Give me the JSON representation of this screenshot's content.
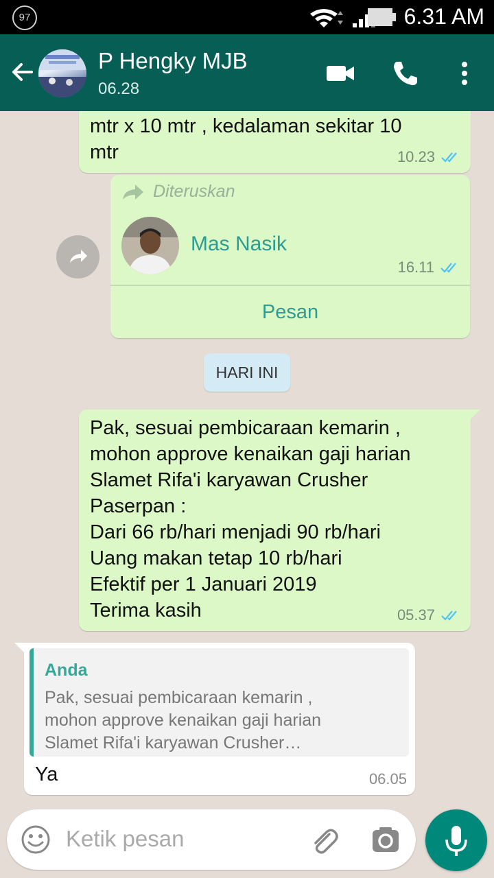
{
  "status_bar": {
    "battery": "97",
    "time": "6.31 AM"
  },
  "header": {
    "contact_name": "P Hengky MJB",
    "last_seen": "06.28"
  },
  "messages": {
    "m1": {
      "text_line1": "mtr x 10 mtr , kedalaman sekitar 10",
      "text_line2": "mtr",
      "time": "10.23"
    },
    "m2": {
      "forwarded_label": "Diteruskan",
      "contact_name": "Mas Nasik",
      "time": "16.11",
      "action_label": "Pesan"
    },
    "date_chip": "HARI INI",
    "m3": {
      "lines": [
        "Pak, sesuai pembicaraan kemarin ,",
        "mohon approve kenaikan gaji harian",
        "Slamet Rifa'i karyawan Crusher",
        "Paserpan :",
        "Dari 66 rb/hari menjadi 90 rb/hari",
        "Uang makan tetap 10 rb/hari",
        "Efektif per 1 Januari 2019",
        "Terima kasih"
      ],
      "time": "05.37"
    },
    "m4": {
      "quote_author": "Anda",
      "quote_lines": [
        "Pak, sesuai pembicaraan kemarin ,",
        "mohon approve kenaikan gaji harian",
        "Slamet Rifa'i karyawan Crusher…"
      ],
      "text": "Ya",
      "time": "06.05"
    }
  },
  "input": {
    "placeholder": "Ketik pesan"
  },
  "colors": {
    "header": "#075e54",
    "outgoing": "#dcf8c6",
    "accent": "#00897b",
    "read_tick": "#4fc3f7"
  }
}
